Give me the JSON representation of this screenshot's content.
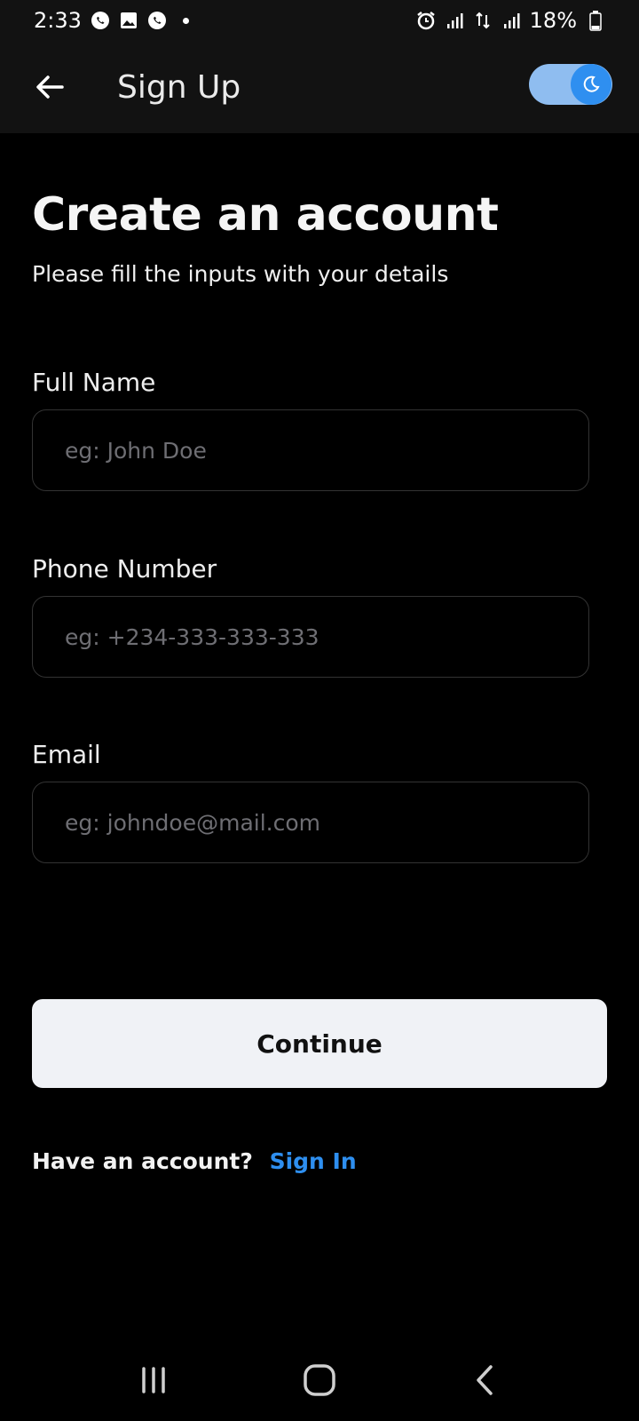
{
  "status_bar": {
    "time": "2:33",
    "battery": "18%",
    "left_icons": [
      "whatsapp-icon",
      "gallery-icon",
      "whatsapp-icon",
      "notification-dot"
    ],
    "right_icons": [
      "alarm-icon",
      "signal-icon",
      "data-transfer-icon",
      "signal-icon",
      "battery-icon"
    ]
  },
  "app_bar": {
    "title": "Sign Up",
    "back_icon": "arrow-left-icon",
    "theme_toggle": {
      "state": "dark",
      "icon": "moon-icon"
    }
  },
  "main": {
    "heading": "Create an account",
    "subheading": "Please fill the inputs with your details",
    "fields": [
      {
        "label": "Full Name",
        "placeholder": "eg: John Doe",
        "value": ""
      },
      {
        "label": "Phone Number",
        "placeholder": "eg: +234-333-333-333",
        "value": ""
      },
      {
        "label": "Email",
        "placeholder": "eg: johndoe@mail.com",
        "value": ""
      }
    ],
    "continue_label": "Continue",
    "have_account_text": "Have an account?",
    "sign_in_label": "Sign In"
  },
  "nav_bar": {
    "icons": [
      "recent-apps-icon",
      "home-icon",
      "back-icon"
    ]
  },
  "colors": {
    "background": "#000000",
    "accent": "#2e8ff0",
    "button_bg": "#f0f2f6",
    "toggle_track": "#8fbdf0"
  }
}
